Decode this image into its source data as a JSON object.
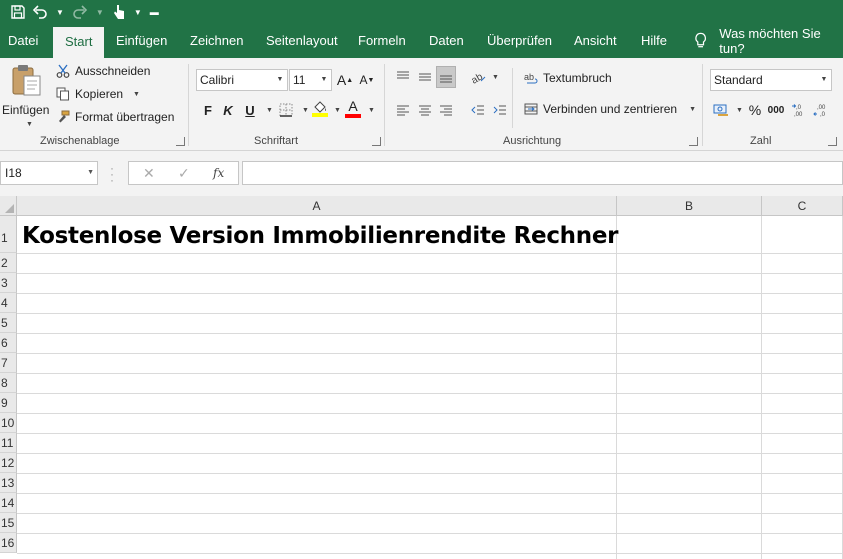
{
  "qat": {
    "icons": [
      "save-icon",
      "undo-icon",
      "redo-icon",
      "touch-mode-icon",
      "customize-icon"
    ]
  },
  "tabs": [
    "Datei",
    "Start",
    "Einfügen",
    "Zeichnen",
    "Seitenlayout",
    "Formeln",
    "Daten",
    "Überprüfen",
    "Ansicht",
    "Hilfe"
  ],
  "active_tab": "Start",
  "tell_me": "Was möchten Sie tun?",
  "ribbon": {
    "clipboard": {
      "paste": "Einfügen",
      "cut": "Ausschneiden",
      "copy": "Kopieren",
      "format_painter": "Format übertragen",
      "label": "Zwischenablage"
    },
    "font": {
      "name": "Calibri",
      "size": "11",
      "bold": "F",
      "italic": "K",
      "underline": "U",
      "font_color_letter": "A",
      "highlight_color": "#ffff00",
      "font_color": "#ff0000",
      "label": "Schriftart"
    },
    "alignment": {
      "wrap_text": "Textumbruch",
      "merge_center": "Verbinden und zentrieren",
      "label": "Ausrichtung"
    },
    "number": {
      "format": "Standard",
      "percent": "%",
      "thousands": "000",
      "label": "Zahl"
    }
  },
  "formula_bar": {
    "name_box": "I18",
    "fx": "fx",
    "formula": ""
  },
  "sheet": {
    "columns": [
      "A",
      "B",
      "C"
    ],
    "rows": [
      "1",
      "2",
      "3",
      "4",
      "5",
      "6",
      "7",
      "8",
      "9",
      "10",
      "11",
      "12",
      "13",
      "14",
      "15",
      "16"
    ],
    "a1": "Kostenlose Version Immobilienrendite Rechner"
  },
  "colors": {
    "excel_green": "#217346",
    "ribbon_bg": "#f3f3f3"
  }
}
